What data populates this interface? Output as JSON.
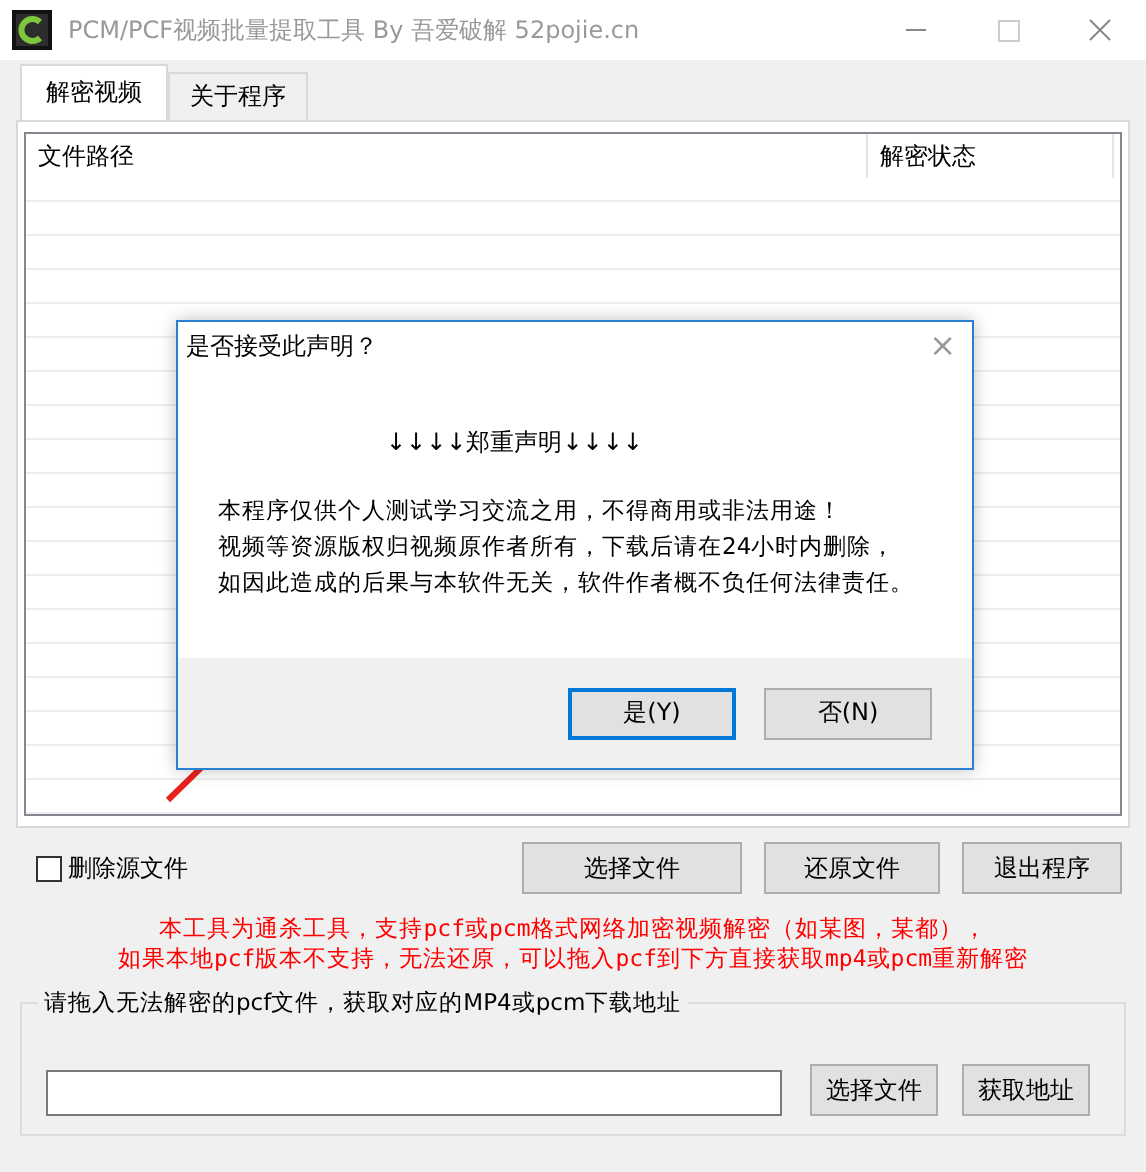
{
  "window": {
    "title": "PCM/PCF视频批量提取工具 By 吾爱破解 52pojie.cn"
  },
  "tabs": [
    {
      "label": "解密视频",
      "selected": true
    },
    {
      "label": "关于程序",
      "selected": false
    }
  ],
  "file_list": {
    "columns": [
      "文件路径",
      "解密状态"
    ]
  },
  "delete_source": {
    "label": "删除源文件",
    "checked": false
  },
  "buttons": [
    "选择文件",
    "还原文件",
    "退出程序"
  ],
  "notice": [
    "本工具为通杀工具，支持pcf或pcm格式网络加密视频解密（如某图，某都），",
    "如果本地pcf版本不支持，无法还原，可以拖入pcf到下方直接获取mp4或pcm重新解密"
  ],
  "download_group": {
    "title": "请拖入无法解密的pcf文件，获取对应的MP4或pcm下载地址",
    "buttons": [
      "选择文件",
      "获取地址"
    ]
  },
  "dialog": {
    "title": "是否接受此声明？",
    "close": "×",
    "heading": "↓↓↓↓郑重声明↓↓↓↓",
    "lines": [
      "本程序仅供个人测试学习交流之用，不得商用或非法用途！",
      "视频等资源版权归视频原作者所有，下载后请在24小时内删除，",
      "如因此造成的后果与本软件无关，软件作者概不负任何法律责任。"
    ],
    "buttons": [
      {
        "label": "是(Y)",
        "selected": true
      },
      {
        "label": "否(N)",
        "selected": false
      }
    ]
  }
}
